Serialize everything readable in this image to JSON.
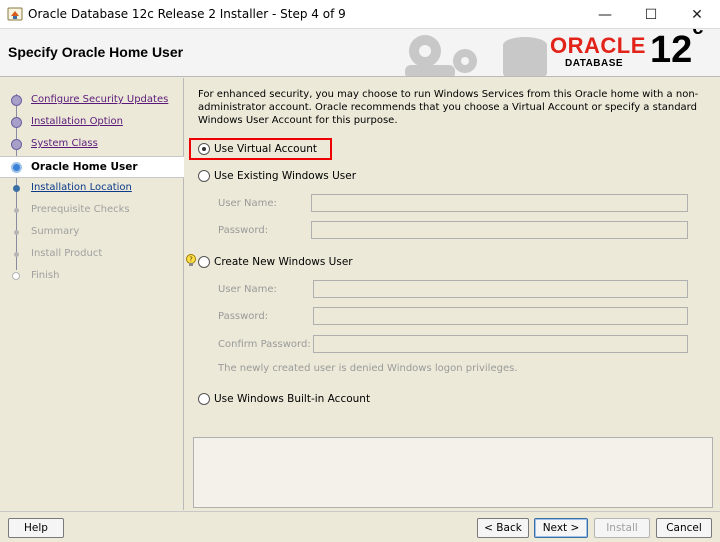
{
  "window": {
    "title": "Oracle Database 12c Release 2 Installer - Step 4 of 9",
    "minimize": "—",
    "maximize": "☐",
    "close": "✕"
  },
  "header": {
    "page_title": "Specify Oracle Home User",
    "logo_oracle": "ORACLE",
    "logo_database": "DATABASE",
    "logo_version": "12",
    "logo_version_sup": "c"
  },
  "steps": [
    {
      "label": "Configure Security Updates",
      "state": "done"
    },
    {
      "label": "Installation Option",
      "state": "done"
    },
    {
      "label": "System Class",
      "state": "done"
    },
    {
      "label": "Oracle Home User",
      "state": "current"
    },
    {
      "label": "Installation Location",
      "state": "next"
    },
    {
      "label": "Prerequisite Checks",
      "state": "future"
    },
    {
      "label": "Summary",
      "state": "future"
    },
    {
      "label": "Install Product",
      "state": "future"
    },
    {
      "label": "Finish",
      "state": "future"
    }
  ],
  "intro_text": "For enhanced security, you may choose to run Windows Services from this Oracle home with a non-administrator account. Oracle recommends that you choose a Virtual Account or specify a standard Windows User Account for this purpose.",
  "options": {
    "virtual_account": "Use Virtual Account",
    "existing_user": "Use Existing Windows User",
    "new_user": "Create New Windows User",
    "builtin_account": "Use Windows Built-in Account"
  },
  "existing_user_fields": {
    "user_name_label": "User Name:",
    "password_label": "Password:"
  },
  "new_user_fields": {
    "user_name_label": "User Name:",
    "password_label": "Password:",
    "confirm_password_label": "Confirm Password:",
    "note": "The newly created user is denied Windows logon privileges."
  },
  "selected_option": "virtual_account",
  "buttons": {
    "help": "Help",
    "back": "< Back",
    "next": "Next >",
    "install": "Install",
    "cancel": "Cancel"
  },
  "colors": {
    "oracle_red": "#e2231a",
    "highlight_box": "#ee0000"
  }
}
